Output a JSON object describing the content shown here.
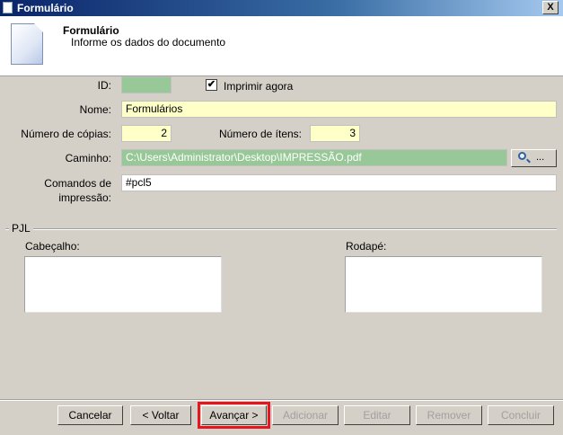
{
  "window": {
    "title": "Formulário",
    "close_glyph": "X"
  },
  "header": {
    "title": "Formulário",
    "subtitle": "Informe os dados do documento",
    "icon": "document-icon"
  },
  "form": {
    "id": {
      "label": "ID:",
      "value": ""
    },
    "print_now": {
      "label": "Imprimir agora",
      "checked": true,
      "glyph": "✔"
    },
    "name": {
      "label": "Nome:",
      "value": "Formulários"
    },
    "copies": {
      "label": "Número de cópias:",
      "value": "2"
    },
    "items": {
      "label": "Número de ítens:",
      "value": "3"
    },
    "path": {
      "label": "Caminho:",
      "value": "C:\\Users\\Administrator\\Desktop\\IMPRESSÃO.pdf"
    },
    "browse": {
      "label": "..."
    },
    "commands": {
      "label": "Comandos de impressão:",
      "value": "#pcl5"
    }
  },
  "pjl": {
    "group_label": "PJL",
    "header_label": "Cabeçalho:",
    "footer_label": "Rodapé:"
  },
  "buttons": {
    "cancel": "Cancelar",
    "back": "< Voltar",
    "next": "Avançar >",
    "add": "Adicionar",
    "edit": "Editar",
    "remove": "Remover",
    "finish": "Concluir"
  },
  "colors": {
    "highlight": "#e8141e",
    "required_field": "#ffffc8",
    "readonly_field": "#98c898"
  }
}
